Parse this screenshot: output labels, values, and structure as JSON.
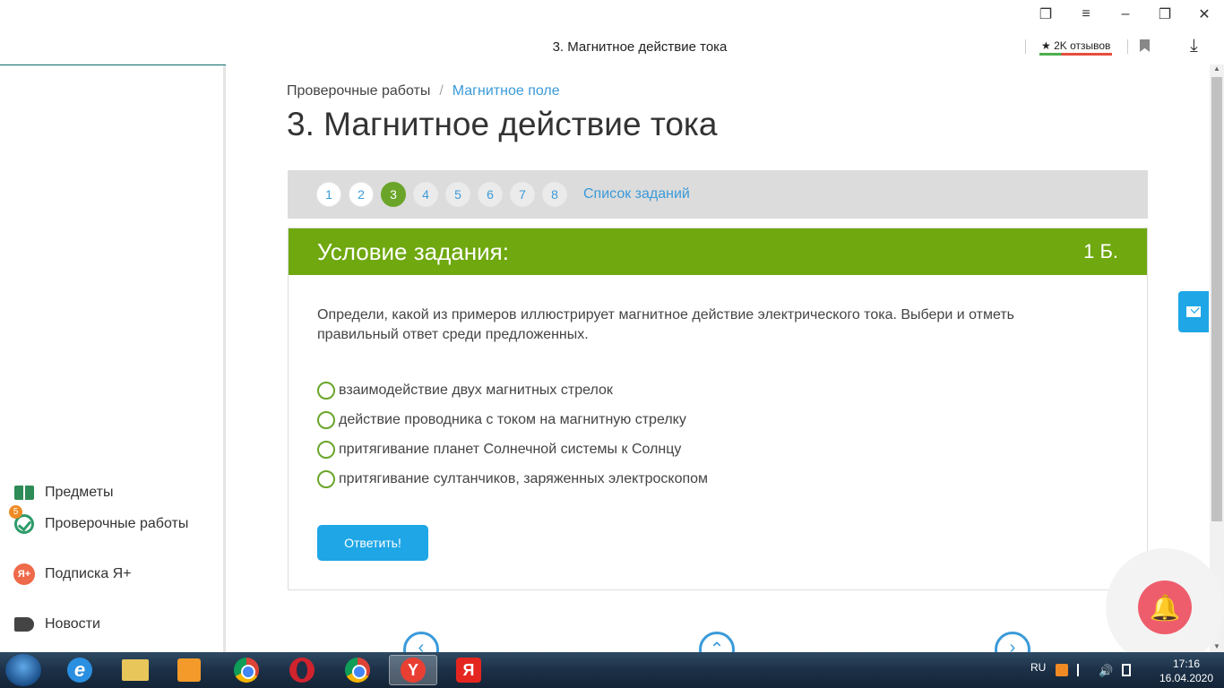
{
  "browser": {
    "page_title": "3. Магнитное действие тока",
    "reviews_label": "★ 2K отзывов"
  },
  "sidebar": {
    "items": [
      {
        "label": "Предметы",
        "icon": "book-icon"
      },
      {
        "label": "Проверочные работы",
        "icon": "check-circle-icon",
        "badge": "5"
      },
      {
        "label": "Подписка Я+",
        "icon": "ya-plus-icon",
        "icon_text": "Я+"
      },
      {
        "label": "Новости",
        "icon": "megaphone-icon"
      }
    ]
  },
  "breadcrumb": {
    "root": "Проверочные работы",
    "separator": "/",
    "current": "Магнитное поле"
  },
  "page": {
    "heading": "3. Магнитное действие тока"
  },
  "steps": {
    "items": [
      "1",
      "2",
      "3",
      "4",
      "5",
      "6",
      "7",
      "8"
    ],
    "active": "3",
    "task_list_link": "Список заданий"
  },
  "task": {
    "header": "Условие задания:",
    "points": "1 Б.",
    "question": "Определи, какой из примеров иллюстрирует магнитное действие электрического тока. Выбери и отметь правильный ответ среди предложенных.",
    "options": [
      "взаимодействие двух магнитных стрелок",
      "действие проводника с током на магнитную стрелку",
      "притягивание планет Солнечной системы к Солнцу",
      "притягивание султанчиков, заряженных электроскопом"
    ],
    "submit_label": "Ответить!"
  },
  "colors": {
    "accent_green": "#6fa80f",
    "link_blue": "#3a9ad9",
    "button_blue": "#1ea6e6",
    "bell_pink": "#ee5d6c"
  },
  "taskbar": {
    "language": "RU",
    "time": "17:16",
    "date": "16.04.2020",
    "apps": [
      "start-orb",
      "internet-explorer-icon",
      "file-explorer-icon",
      "media-player-icon",
      "chrome-icon",
      "opera-icon",
      "chrome-icon",
      "yandex-browser-icon",
      "yandex-icon"
    ]
  }
}
